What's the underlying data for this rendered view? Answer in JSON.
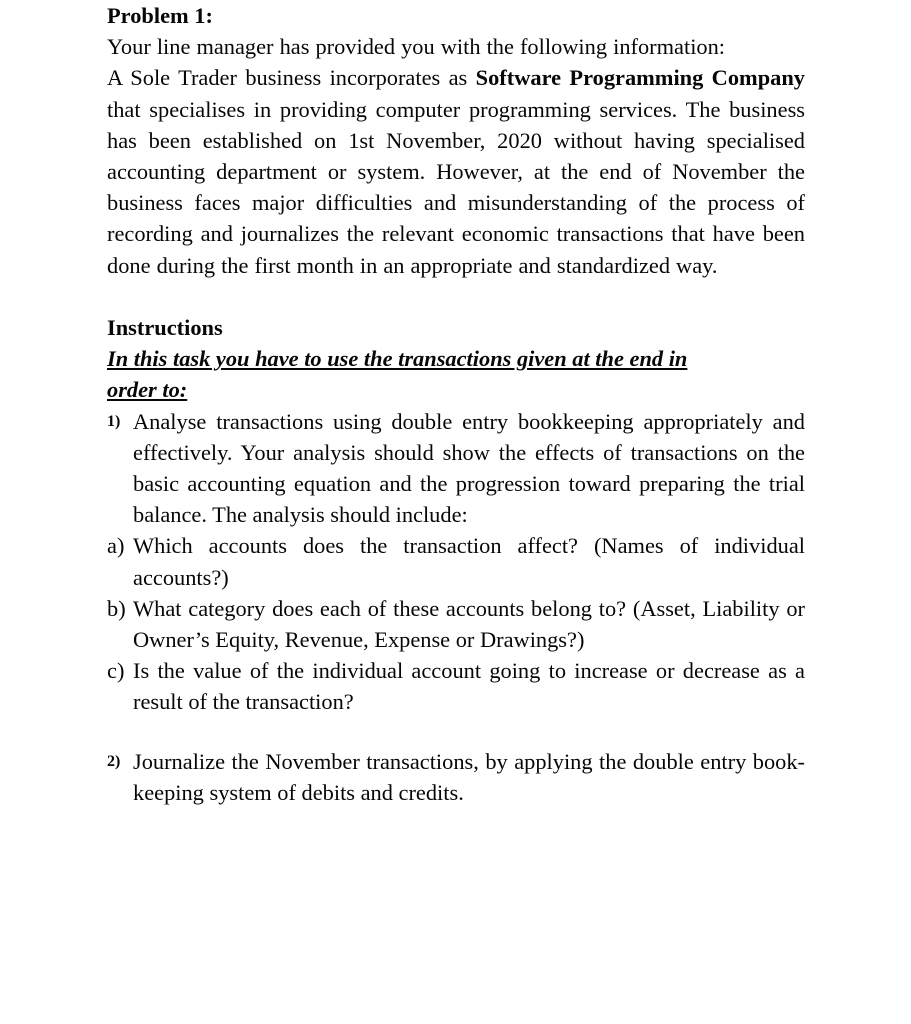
{
  "document": {
    "problem_title": "Problem 1:",
    "intro_paragraph": {
      "line_1": "Your line manager has provided you with the following information:",
      "full_text_prefix": "A Sole Trader business incorporates as ",
      "bold_company_name": "Software Programming Company",
      "full_text_suffix": " that specialises in providing computer programming services. The business has been established on 1st November, 2020 without having specialised accounting department or system. However, at the end of November the business faces major difficulties and misunderstanding of the process of recording and journalizes the relevant economic transactions that have been done during the first month in an appropriate and standardized way."
    },
    "instructions_heading": "Instructions",
    "instructions_subheading_line_1": "In this task you have to use the transactions given at the end in",
    "instructions_subheading_line_2": "order to:",
    "items": [
      {
        "marker": "1)",
        "marker_style": "small",
        "text": "Analyse transactions using double entry bookkeeping appropriately and effectively. Your analysis should show the effects of transactions on the basic accounting equation and the progression toward preparing the trial balance. The analysis should include:"
      },
      {
        "marker": "a)",
        "marker_style": "normal",
        "text": "Which accounts does the transaction affect? (Names of individual accounts?)"
      },
      {
        "marker": "b)",
        "marker_style": "normal",
        "text": "What category does each of these accounts belong to? (Asset, Liability or Owner’s Equity, Revenue, Expense or Drawings?)"
      },
      {
        "marker": "c)",
        "marker_style": "normal",
        "text": "Is the value of the individual account going to increase or decrease as a result of the transaction?"
      },
      {
        "marker": "2)",
        "marker_style": "small",
        "text": "Journalize the November transactions, by applying the double entry book-keeping system of debits and credits."
      }
    ]
  }
}
